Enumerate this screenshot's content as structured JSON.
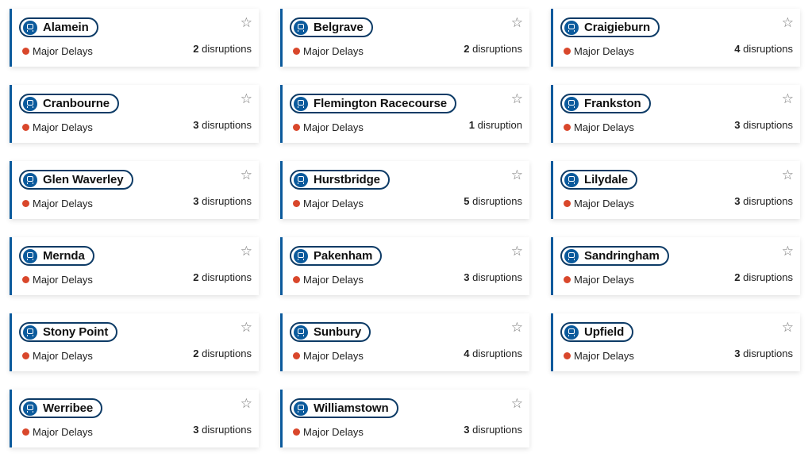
{
  "colors": {
    "accent": "#0b5a9c",
    "pill_border": "#0d3b66",
    "status_major": "#d9472b"
  },
  "icons": {
    "line": "train-icon",
    "favourite": "star-outline-icon",
    "status": "red-dot-icon"
  },
  "lines": [
    {
      "name": "Alamein",
      "status": "Major Delays",
      "count": "2",
      "unit": "disruptions"
    },
    {
      "name": "Belgrave",
      "status": "Major Delays",
      "count": "2",
      "unit": "disruptions"
    },
    {
      "name": "Craigieburn",
      "status": "Major Delays",
      "count": "4",
      "unit": "disruptions"
    },
    {
      "name": "Cranbourne",
      "status": "Major Delays",
      "count": "3",
      "unit": "disruptions"
    },
    {
      "name": "Flemington Racecourse",
      "status": "Major Delays",
      "count": "1",
      "unit": "disruption"
    },
    {
      "name": "Frankston",
      "status": "Major Delays",
      "count": "3",
      "unit": "disruptions"
    },
    {
      "name": "Glen Waverley",
      "status": "Major Delays",
      "count": "3",
      "unit": "disruptions"
    },
    {
      "name": "Hurstbridge",
      "status": "Major Delays",
      "count": "5",
      "unit": "disruptions"
    },
    {
      "name": "Lilydale",
      "status": "Major Delays",
      "count": "3",
      "unit": "disruptions"
    },
    {
      "name": "Mernda",
      "status": "Major Delays",
      "count": "2",
      "unit": "disruptions"
    },
    {
      "name": "Pakenham",
      "status": "Major Delays",
      "count": "3",
      "unit": "disruptions"
    },
    {
      "name": "Sandringham",
      "status": "Major Delays",
      "count": "2",
      "unit": "disruptions"
    },
    {
      "name": "Stony Point",
      "status": "Major Delays",
      "count": "2",
      "unit": "disruptions"
    },
    {
      "name": "Sunbury",
      "status": "Major Delays",
      "count": "4",
      "unit": "disruptions"
    },
    {
      "name": "Upfield",
      "status": "Major Delays",
      "count": "3",
      "unit": "disruptions"
    },
    {
      "name": "Werribee",
      "status": "Major Delays",
      "count": "3",
      "unit": "disruptions"
    },
    {
      "name": "Williamstown",
      "status": "Major Delays",
      "count": "3",
      "unit": "disruptions"
    }
  ]
}
